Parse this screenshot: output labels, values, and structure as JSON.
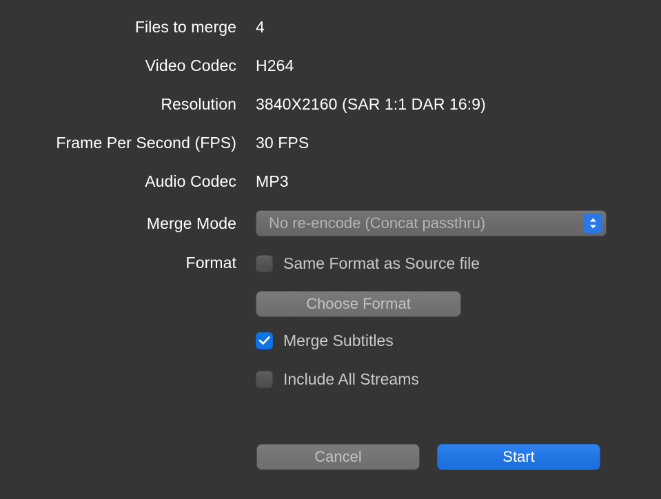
{
  "colors": {
    "background": "#353535",
    "label_text": "#ffffff",
    "value_text": "#ffffff",
    "dimmed_text": "#c9c9c9",
    "control_fill": "#6e6e6e",
    "accent_blue": "#1273e6",
    "start_blue": "#2176e4"
  },
  "info_rows": [
    {
      "label": "Files to merge",
      "value": "4"
    },
    {
      "label": "Video Codec",
      "value": "H264"
    },
    {
      "label": "Resolution",
      "value": "3840X2160 (SAR 1:1 DAR 16:9)"
    },
    {
      "label": "Frame Per Second (FPS)",
      "value": "30 FPS"
    },
    {
      "label": "Audio Codec",
      "value": "MP3"
    }
  ],
  "merge_mode": {
    "label": "Merge Mode",
    "selected": "No re-encode (Concat passthru)",
    "stepper_icon": "chevron-up-down-icon"
  },
  "format": {
    "label": "Format",
    "same_format_checkbox": {
      "label": "Same Format as Source file",
      "checked": false,
      "icon": "checkbox-unchecked-icon"
    },
    "choose_format_button": "Choose Format"
  },
  "options": [
    {
      "label": "Merge Subtitles",
      "checked": true,
      "icon": "checkbox-checked-icon"
    },
    {
      "label": "Include All Streams",
      "checked": false,
      "icon": "checkbox-unchecked-icon"
    }
  ],
  "footer": {
    "cancel_label": "Cancel",
    "start_label": "Start"
  }
}
